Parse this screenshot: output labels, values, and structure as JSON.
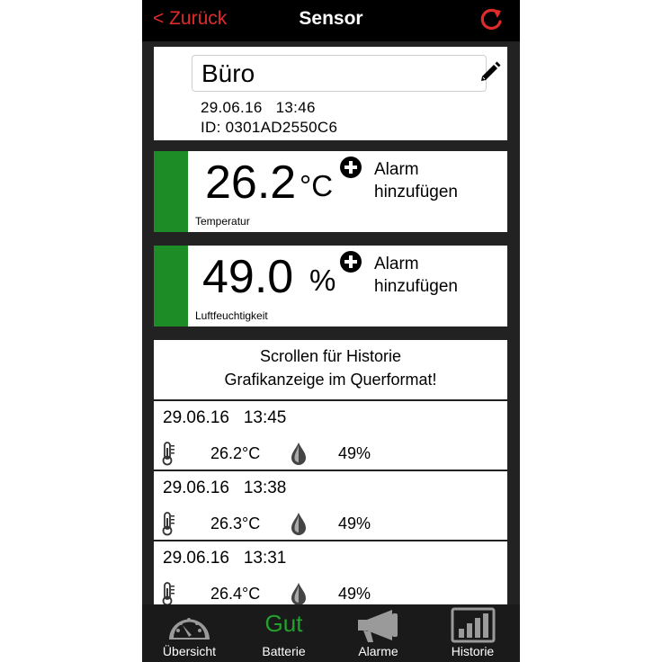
{
  "header": {
    "back_label": "< Zurück",
    "title": "Sensor"
  },
  "sensor": {
    "name": "Büro",
    "date": "29.06.16",
    "time": "13:46",
    "id_label": "ID: 0301AD2550C6"
  },
  "temperature": {
    "value": "26.2",
    "unit": "°C",
    "label": "Temperatur",
    "alarm_line1": "Alarm",
    "alarm_line2": "hinzufügen"
  },
  "humidity": {
    "value": "49.0",
    "unit": "%",
    "label": "Luftfeuchtigkeit",
    "alarm_line1": "Alarm",
    "alarm_line2": "hinzufügen"
  },
  "info": {
    "line1": "Scrollen für Historie",
    "line2": "Grafikanzeige im Querformat!"
  },
  "history": [
    {
      "date": "29.06.16",
      "time": "13:45",
      "temp": "26.2°C",
      "hum": "49%"
    },
    {
      "date": "29.06.16",
      "time": "13:38",
      "temp": "26.3°C",
      "hum": "49%"
    },
    {
      "date": "29.06.16",
      "time": "13:31",
      "temp": "26.4°C",
      "hum": "49%"
    }
  ],
  "tabs": {
    "overview": "Übersicht",
    "battery": "Batterie",
    "battery_status": "Gut",
    "alarms": "Alarme",
    "history": "Historie"
  },
  "colors": {
    "accent_red": "#e12a2a",
    "status_green": "#1e8c26",
    "battery_ok": "#23a12d"
  }
}
